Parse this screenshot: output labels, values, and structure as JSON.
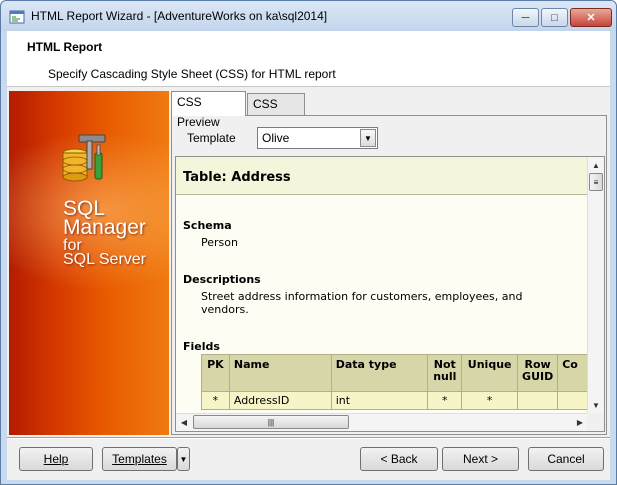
{
  "window": {
    "title": "HTML Report Wizard - [AdventureWorks on ka\\sql2014]"
  },
  "header": {
    "title": "HTML Report",
    "subtitle": "Specify Cascading Style Sheet (CSS) for HTML report"
  },
  "banner": {
    "line1": "SQL",
    "line2": "Manager",
    "line3": "for",
    "line4": "SQL Server"
  },
  "tabs": [
    {
      "label": "CSS Preview",
      "active": true
    },
    {
      "label": "CSS Text",
      "active": false
    }
  ],
  "template": {
    "label": "Template",
    "value": "Olive"
  },
  "preview": {
    "table_title": "Table: Address",
    "schema_heading": "Schema",
    "schema_value": "Person",
    "descriptions_heading": "Descriptions",
    "descriptions_value": "Street address information for customers, employees, and vendors.",
    "fields_heading": "Fields",
    "columns": [
      "PK",
      "Name",
      "Data type",
      "Not null",
      "Unique",
      "Row GUID",
      "Co"
    ],
    "rows": [
      [
        "*",
        "AddressID",
        "int",
        "*",
        "*",
        "",
        ""
      ]
    ]
  },
  "buttons": {
    "help": "Help",
    "templates": "Templates",
    "back": "< Back",
    "next": "Next >",
    "cancel": "Cancel"
  },
  "colors": {
    "banner_orange": "#e85a00",
    "preview_header_bg": "#d6d6a8",
    "preview_cell_bg": "#f5f5c8"
  }
}
